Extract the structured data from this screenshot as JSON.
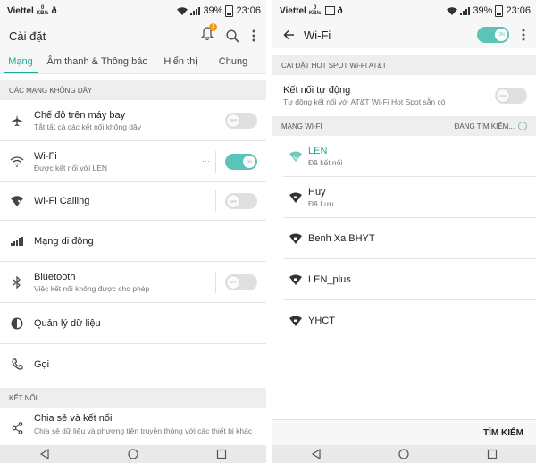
{
  "left": {
    "status": {
      "carrier": "Viettel",
      "speed_value": "0",
      "speed_unit": "KB/s",
      "battery": "39%",
      "time": "23:06"
    },
    "title": "Cài đặt",
    "notification_count": "1",
    "tabs": [
      {
        "label": "Mạng",
        "active": true
      },
      {
        "label": "Âm thanh & Thông báo",
        "active": false
      },
      {
        "label": "Hiển thị",
        "active": false
      },
      {
        "label": "Chung",
        "active": false
      }
    ],
    "section_wireless": "CÁC MẠNG KHÔNG DÂY",
    "items": {
      "airplane": {
        "title": "Chế độ trên máy bay",
        "subtitle": "Tắt tất cả các kết nối không dây",
        "toggle": "OFF"
      },
      "wifi": {
        "title": "Wi-Fi",
        "subtitle": "Được kết nối với LEN",
        "toggle": "ON"
      },
      "wifi_calling": {
        "title": "Wi-Fi Calling",
        "toggle": "OFF"
      },
      "mobile": {
        "title": "Mạng di động"
      },
      "bluetooth": {
        "title": "Bluetooth",
        "subtitle": "Việc kết nối không được cho phép",
        "toggle": "OFF"
      },
      "data": {
        "title": "Quản lý dữ liệu"
      },
      "call": {
        "title": "Gọi"
      }
    },
    "section_connect": "KẾT NỐI",
    "share": {
      "title": "Chia sẻ và kết nối",
      "subtitle": "Chia sẻ dữ liệu và phương tiện truyền thông với các thiết bị khác"
    }
  },
  "right": {
    "status": {
      "carrier": "Viettel",
      "speed_value": "0",
      "speed_unit": "KB/s",
      "battery": "39%",
      "time": "23:06"
    },
    "title": "Wi-Fi",
    "main_switch": "ON",
    "section_hotspot": "CÀI ĐẶT HOT SPOT WI-FI AT&T",
    "auto_connect": {
      "title": "Kết nối tự động",
      "subtitle": "Tự động kết nối với AT&T Wi-Fi Hot Spot sẵn có",
      "toggle": "OFF"
    },
    "section_networks": "MẠNG WI-FI",
    "searching": "ĐANG TÌM KIẾM...",
    "networks": [
      {
        "name": "LEN",
        "status": "Đã kết nối"
      },
      {
        "name": "Huy",
        "status": "Đã Lưu"
      },
      {
        "name": "Benh Xa BHYT",
        "status": ""
      },
      {
        "name": "LEN_plus",
        "status": ""
      },
      {
        "name": "YHCT",
        "status": ""
      }
    ],
    "search_button": "TÌM KIẾM"
  },
  "colors": {
    "accent": "#1aa89a",
    "toggle_on": "#5ac4b8",
    "section_bg": "#eeeeee",
    "notification": "#f39c12"
  }
}
